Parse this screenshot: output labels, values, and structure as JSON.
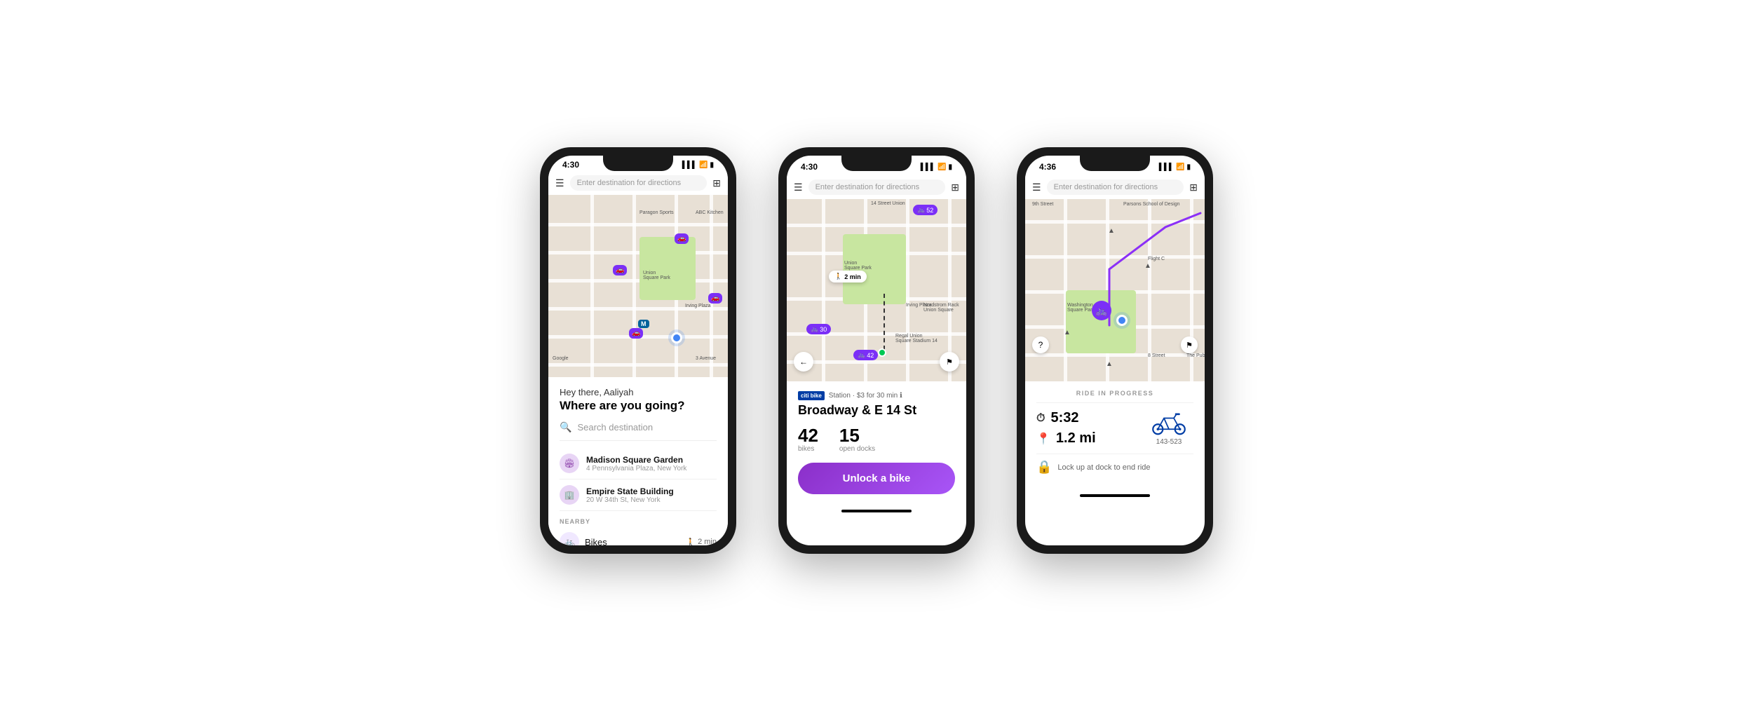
{
  "app": {
    "name": "Citi Bike App",
    "accent_color": "#8b2ff7"
  },
  "phone1": {
    "status_bar": {
      "time": "4:30",
      "signal": "▌▌▌",
      "wifi": "WiFi",
      "battery": "🔋"
    },
    "header": {
      "menu_icon": "☰",
      "search_placeholder": "Enter destination for directions",
      "grid_icon": "⊞"
    },
    "bottom": {
      "greeting": "Hey there, Aaliyah",
      "heading": "Where are you going?",
      "search_placeholder": "Search destination",
      "recent_items": [
        {
          "name": "Madison Square Garden",
          "address": "4 Pennsylvania Plaza, New York"
        },
        {
          "name": "Empire State Building",
          "address": "20 W 34th St, New York"
        }
      ],
      "nearby_label": "NEARBY",
      "nearby_items": [
        {
          "type": "Bikes",
          "walk_time": "2 min"
        }
      ]
    }
  },
  "phone2": {
    "status_bar": {
      "time": "4:30"
    },
    "header": {
      "search_placeholder": "Enter destination for directions"
    },
    "map": {
      "bike_count_1": "52",
      "bike_count_2": "30",
      "bike_count_3": "42",
      "walk_time": "2 min"
    },
    "station": {
      "brand": "citi bike",
      "meta": "Station · $3 for 30 min",
      "name": "Broadway & E 14 St",
      "bikes_count": "42",
      "bikes_label": "bikes",
      "docks_count": "15",
      "docks_label": "open docks",
      "unlock_label": "Unlock a bike"
    }
  },
  "phone3": {
    "status_bar": {
      "time": "4:36"
    },
    "header": {
      "search_placeholder": "Enter destination for directions"
    },
    "ride": {
      "header": "RIDE IN PROGRESS",
      "time": "5:32",
      "distance": "1.2 mi",
      "bike_id": "143-523",
      "lock_instruction": "Lock up at dock to end ride"
    }
  }
}
